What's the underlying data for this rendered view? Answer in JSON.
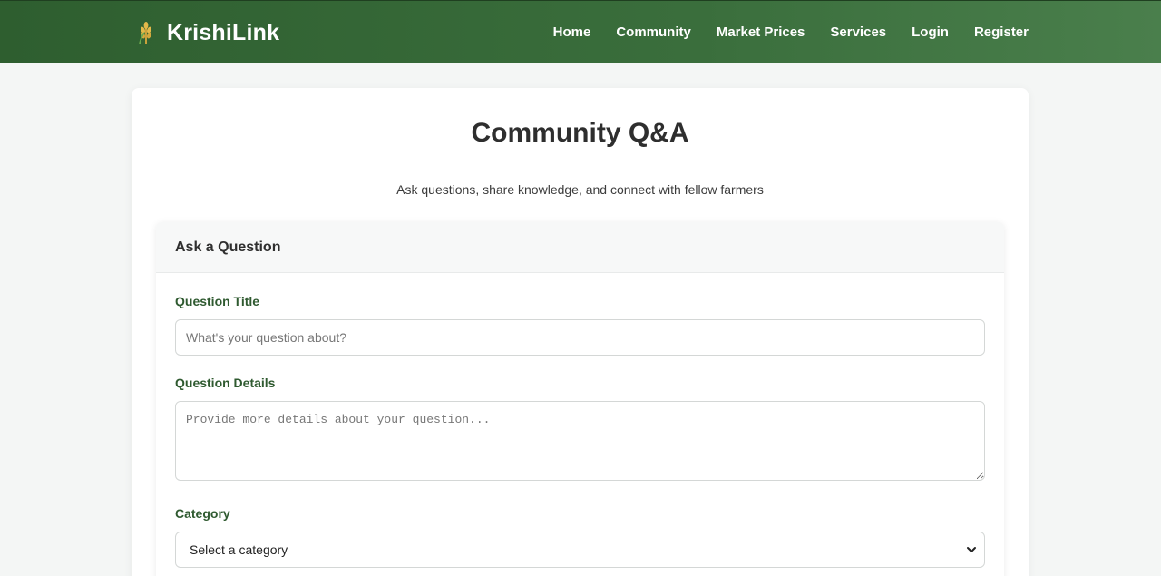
{
  "brand": {
    "name": "KrishiLink",
    "icon": "wheat-icon"
  },
  "nav": {
    "links": [
      "Home",
      "Community",
      "Market Prices",
      "Services",
      "Login",
      "Register"
    ]
  },
  "page": {
    "title": "Community Q&A",
    "subtitle": "Ask questions, share knowledge, and connect with fellow farmers"
  },
  "form": {
    "header": "Ask a Question",
    "title_label": "Question Title",
    "title_placeholder": "What's your question about?",
    "title_value": "",
    "details_label": "Question Details",
    "details_placeholder": "Provide more details about your question...",
    "details_value": "",
    "category_label": "Category",
    "category_selected": "Select a category"
  },
  "colors": {
    "nav_bg": "#2e5e2f",
    "label_green": "#2f5a30",
    "page_bg": "#f4f6f5"
  }
}
